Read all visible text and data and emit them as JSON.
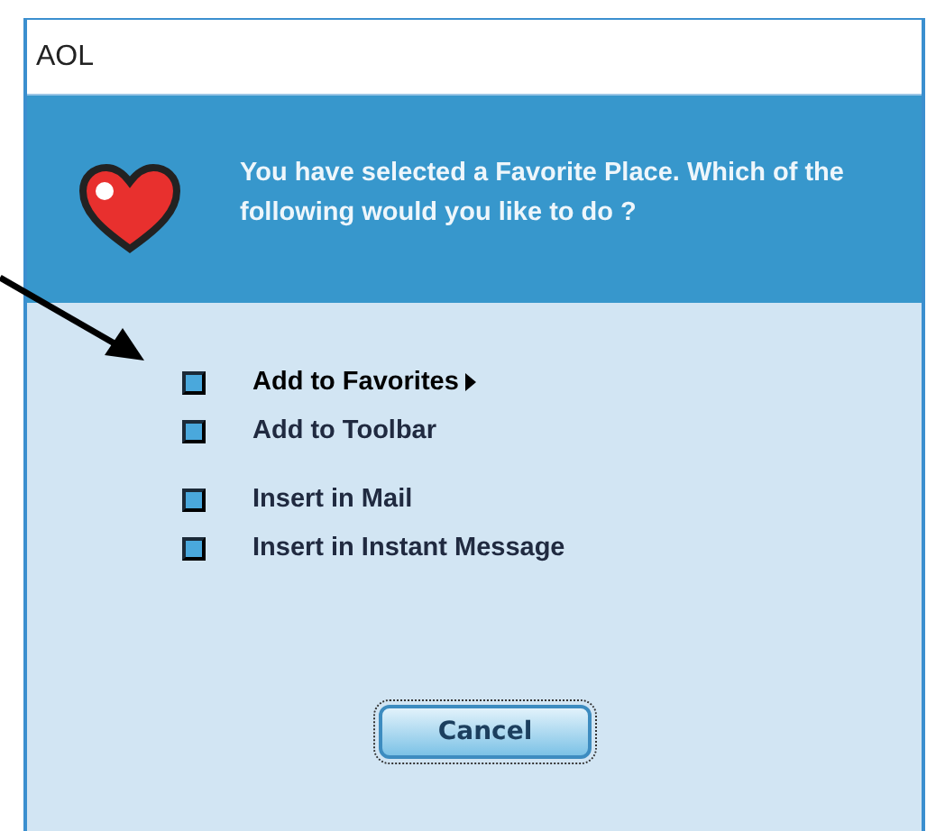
{
  "window": {
    "title": "AOL"
  },
  "header": {
    "message": "You have selected a Favorite Place. Which of the following would you like to do ?"
  },
  "option_groups": [
    {
      "options": [
        {
          "label": "Add to Favorites",
          "selected": true,
          "has_submenu": true
        },
        {
          "label": "Add to Toolbar",
          "selected": false,
          "has_submenu": false
        }
      ]
    },
    {
      "options": [
        {
          "label": "Insert in Mail",
          "selected": false,
          "has_submenu": false
        },
        {
          "label": "Insert in Instant Message",
          "selected": false,
          "has_submenu": false
        }
      ]
    }
  ],
  "buttons": [
    {
      "label": "Cancel",
      "focused": true
    }
  ]
}
